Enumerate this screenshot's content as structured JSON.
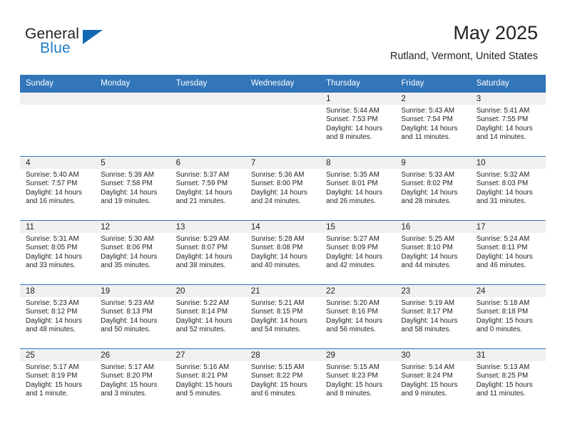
{
  "logo": {
    "word1": "General",
    "word2": "Blue",
    "triangle_color": "#1268b3",
    "blue_color": "#1d7cc4"
  },
  "header": {
    "title": "May 2025",
    "subtitle": "Rutland, Vermont, United States",
    "header_bg": "#3275b9",
    "daynum_bg": "#f0f0f0"
  },
  "weekday_headers": [
    "Sunday",
    "Monday",
    "Tuesday",
    "Wednesday",
    "Thursday",
    "Friday",
    "Saturday"
  ],
  "weeks": [
    [
      {
        "day": "",
        "sunrise": "",
        "sunset": "",
        "daylight1": "",
        "daylight2": ""
      },
      {
        "day": "",
        "sunrise": "",
        "sunset": "",
        "daylight1": "",
        "daylight2": ""
      },
      {
        "day": "",
        "sunrise": "",
        "sunset": "",
        "daylight1": "",
        "daylight2": ""
      },
      {
        "day": "",
        "sunrise": "",
        "sunset": "",
        "daylight1": "",
        "daylight2": ""
      },
      {
        "day": "1",
        "sunrise": "Sunrise: 5:44 AM",
        "sunset": "Sunset: 7:53 PM",
        "daylight1": "Daylight: 14 hours",
        "daylight2": "and 8 minutes."
      },
      {
        "day": "2",
        "sunrise": "Sunrise: 5:43 AM",
        "sunset": "Sunset: 7:54 PM",
        "daylight1": "Daylight: 14 hours",
        "daylight2": "and 11 minutes."
      },
      {
        "day": "3",
        "sunrise": "Sunrise: 5:41 AM",
        "sunset": "Sunset: 7:55 PM",
        "daylight1": "Daylight: 14 hours",
        "daylight2": "and 14 minutes."
      }
    ],
    [
      {
        "day": "4",
        "sunrise": "Sunrise: 5:40 AM",
        "sunset": "Sunset: 7:57 PM",
        "daylight1": "Daylight: 14 hours",
        "daylight2": "and 16 minutes."
      },
      {
        "day": "5",
        "sunrise": "Sunrise: 5:39 AM",
        "sunset": "Sunset: 7:58 PM",
        "daylight1": "Daylight: 14 hours",
        "daylight2": "and 19 minutes."
      },
      {
        "day": "6",
        "sunrise": "Sunrise: 5:37 AM",
        "sunset": "Sunset: 7:59 PM",
        "daylight1": "Daylight: 14 hours",
        "daylight2": "and 21 minutes."
      },
      {
        "day": "7",
        "sunrise": "Sunrise: 5:36 AM",
        "sunset": "Sunset: 8:00 PM",
        "daylight1": "Daylight: 14 hours",
        "daylight2": "and 24 minutes."
      },
      {
        "day": "8",
        "sunrise": "Sunrise: 5:35 AM",
        "sunset": "Sunset: 8:01 PM",
        "daylight1": "Daylight: 14 hours",
        "daylight2": "and 26 minutes."
      },
      {
        "day": "9",
        "sunrise": "Sunrise: 5:33 AM",
        "sunset": "Sunset: 8:02 PM",
        "daylight1": "Daylight: 14 hours",
        "daylight2": "and 28 minutes."
      },
      {
        "day": "10",
        "sunrise": "Sunrise: 5:32 AM",
        "sunset": "Sunset: 8:03 PM",
        "daylight1": "Daylight: 14 hours",
        "daylight2": "and 31 minutes."
      }
    ],
    [
      {
        "day": "11",
        "sunrise": "Sunrise: 5:31 AM",
        "sunset": "Sunset: 8:05 PM",
        "daylight1": "Daylight: 14 hours",
        "daylight2": "and 33 minutes."
      },
      {
        "day": "12",
        "sunrise": "Sunrise: 5:30 AM",
        "sunset": "Sunset: 8:06 PM",
        "daylight1": "Daylight: 14 hours",
        "daylight2": "and 35 minutes."
      },
      {
        "day": "13",
        "sunrise": "Sunrise: 5:29 AM",
        "sunset": "Sunset: 8:07 PM",
        "daylight1": "Daylight: 14 hours",
        "daylight2": "and 38 minutes."
      },
      {
        "day": "14",
        "sunrise": "Sunrise: 5:28 AM",
        "sunset": "Sunset: 8:08 PM",
        "daylight1": "Daylight: 14 hours",
        "daylight2": "and 40 minutes."
      },
      {
        "day": "15",
        "sunrise": "Sunrise: 5:27 AM",
        "sunset": "Sunset: 8:09 PM",
        "daylight1": "Daylight: 14 hours",
        "daylight2": "and 42 minutes."
      },
      {
        "day": "16",
        "sunrise": "Sunrise: 5:25 AM",
        "sunset": "Sunset: 8:10 PM",
        "daylight1": "Daylight: 14 hours",
        "daylight2": "and 44 minutes."
      },
      {
        "day": "17",
        "sunrise": "Sunrise: 5:24 AM",
        "sunset": "Sunset: 8:11 PM",
        "daylight1": "Daylight: 14 hours",
        "daylight2": "and 46 minutes."
      }
    ],
    [
      {
        "day": "18",
        "sunrise": "Sunrise: 5:23 AM",
        "sunset": "Sunset: 8:12 PM",
        "daylight1": "Daylight: 14 hours",
        "daylight2": "and 48 minutes."
      },
      {
        "day": "19",
        "sunrise": "Sunrise: 5:23 AM",
        "sunset": "Sunset: 8:13 PM",
        "daylight1": "Daylight: 14 hours",
        "daylight2": "and 50 minutes."
      },
      {
        "day": "20",
        "sunrise": "Sunrise: 5:22 AM",
        "sunset": "Sunset: 8:14 PM",
        "daylight1": "Daylight: 14 hours",
        "daylight2": "and 52 minutes."
      },
      {
        "day": "21",
        "sunrise": "Sunrise: 5:21 AM",
        "sunset": "Sunset: 8:15 PM",
        "daylight1": "Daylight: 14 hours",
        "daylight2": "and 54 minutes."
      },
      {
        "day": "22",
        "sunrise": "Sunrise: 5:20 AM",
        "sunset": "Sunset: 8:16 PM",
        "daylight1": "Daylight: 14 hours",
        "daylight2": "and 56 minutes."
      },
      {
        "day": "23",
        "sunrise": "Sunrise: 5:19 AM",
        "sunset": "Sunset: 8:17 PM",
        "daylight1": "Daylight: 14 hours",
        "daylight2": "and 58 minutes."
      },
      {
        "day": "24",
        "sunrise": "Sunrise: 5:18 AM",
        "sunset": "Sunset: 8:18 PM",
        "daylight1": "Daylight: 15 hours",
        "daylight2": "and 0 minutes."
      }
    ],
    [
      {
        "day": "25",
        "sunrise": "Sunrise: 5:17 AM",
        "sunset": "Sunset: 8:19 PM",
        "daylight1": "Daylight: 15 hours",
        "daylight2": "and 1 minute."
      },
      {
        "day": "26",
        "sunrise": "Sunrise: 5:17 AM",
        "sunset": "Sunset: 8:20 PM",
        "daylight1": "Daylight: 15 hours",
        "daylight2": "and 3 minutes."
      },
      {
        "day": "27",
        "sunrise": "Sunrise: 5:16 AM",
        "sunset": "Sunset: 8:21 PM",
        "daylight1": "Daylight: 15 hours",
        "daylight2": "and 5 minutes."
      },
      {
        "day": "28",
        "sunrise": "Sunrise: 5:15 AM",
        "sunset": "Sunset: 8:22 PM",
        "daylight1": "Daylight: 15 hours",
        "daylight2": "and 6 minutes."
      },
      {
        "day": "29",
        "sunrise": "Sunrise: 5:15 AM",
        "sunset": "Sunset: 8:23 PM",
        "daylight1": "Daylight: 15 hours",
        "daylight2": "and 8 minutes."
      },
      {
        "day": "30",
        "sunrise": "Sunrise: 5:14 AM",
        "sunset": "Sunset: 8:24 PM",
        "daylight1": "Daylight: 15 hours",
        "daylight2": "and 9 minutes."
      },
      {
        "day": "31",
        "sunrise": "Sunrise: 5:13 AM",
        "sunset": "Sunset: 8:25 PM",
        "daylight1": "Daylight: 15 hours",
        "daylight2": "and 11 minutes."
      }
    ]
  ]
}
